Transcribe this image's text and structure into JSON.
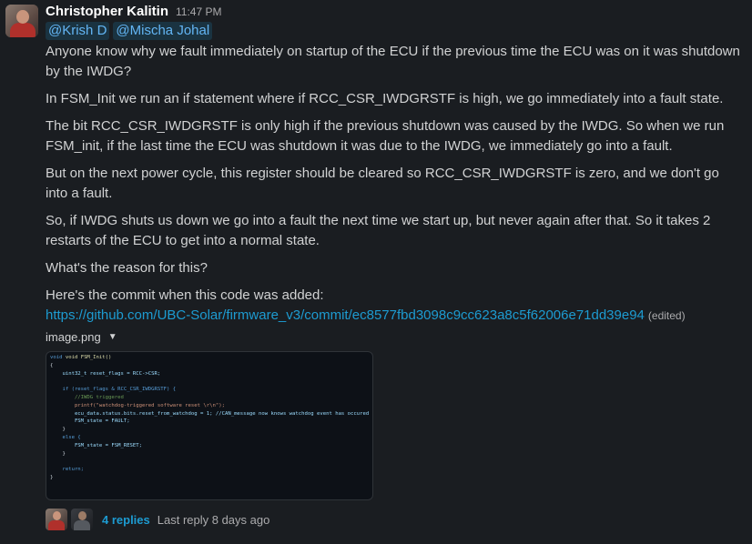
{
  "message": {
    "author": "Christopher Kalitin",
    "time": "11:47 PM",
    "mentions": [
      "@Krish D",
      "@Mischa Johal"
    ],
    "paragraphs": [
      "Anyone know why we fault immediately on startup of the ECU if the previous time the ECU was on it was shutdown by the IWDG?",
      "In FSM_Init we run an if statement where if RCC_CSR_IWDGRSTF is high, we go immediately into a fault state.",
      "The bit RCC_CSR_IWDGRSTF is only high if the previous shutdown was caused by the IWDG. So when we run FSM_init, if the last time the ECU was shutdown it was due to the IWDG, we immediately go into a fault.",
      "But on the next power cycle, this register should be cleared so RCC_CSR_IWDGRSTF  is zero, and we don't go into a fault.",
      "So, if IWDG shuts us down we go into a fault the next time we start up, but never again after that. So it takes 2 restarts of the ECU to get into a normal state.",
      "What's the reason for this?",
      "Here's the commit when this code was added:"
    ],
    "link": "https://github.com/UBC-Solar/firmware_v3/commit/ec8577fbd3098c9cc623a8c5f62006e71dd39e94",
    "edited": "(edited)"
  },
  "attachment": {
    "filename": "image.png",
    "code_lines": [
      "void FSM_Init()",
      "{",
      "    uint32_t reset_flags = RCC->CSR;",
      "",
      "    if (reset_flags & RCC_CSR_IWDGRSTF) {",
      "        //IWDG triggered",
      "        printf(\"watchdog-triggered software reset \\r\\n\");",
      "        ecu_data.status.bits.reset_from_watchdog = 1; //CAN_message now knows watchdog event has occured",
      "        FSM_state = FAULT;",
      "    }",
      "    else {",
      "        FSM_state = FSM_RESET;",
      "    }",
      "",
      "    return;",
      "}"
    ]
  },
  "thread": {
    "reply_count": "4 replies",
    "last_reply": "Last reply 8 days ago"
  }
}
